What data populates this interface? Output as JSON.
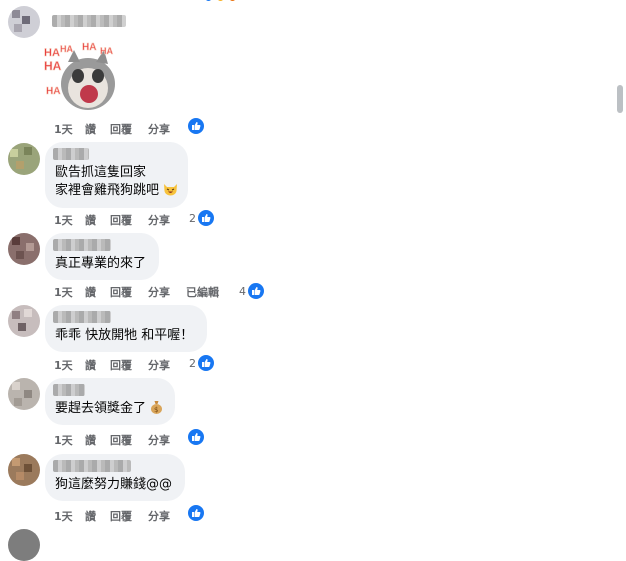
{
  "comments": [
    {
      "sticker": {
        "text": "HAHA",
        "colors": {
          "text": "#e8383a",
          "outline": "#f6c8b6"
        }
      },
      "actions": {
        "time": "1天",
        "like": "讚",
        "reply": "回覆",
        "share": "分享"
      },
      "reactions": null
    },
    {
      "lines": [
        "歐告抓這隻回家",
        "家裡會雞飛狗跳吧"
      ],
      "emoji": "laughing-cat-face",
      "actions": {
        "time": "1天",
        "like": "讚",
        "reply": "回覆",
        "share": "分享"
      },
      "reactions": "2"
    },
    {
      "lines": [
        "真正專業的來了"
      ],
      "actions": {
        "time": "1天",
        "like": "讚",
        "reply": "回覆",
        "share": "分享",
        "edited": "已編輯"
      },
      "reactions": "4"
    },
    {
      "lines": [
        "乖乖 快放開牠 和平喔！"
      ],
      "actions": {
        "time": "1天",
        "like": "讚",
        "reply": "回覆",
        "share": "分享"
      },
      "reactions": "2"
    },
    {
      "lines": [
        "要趕去領獎金了"
      ],
      "emoji": "money-bag",
      "actions": {
        "time": "1天",
        "like": "讚",
        "reply": "回覆",
        "share": "分享"
      },
      "reactions": null
    },
    {
      "lines": [
        "狗這麼努力賺錢@@"
      ],
      "actions": {
        "time": "1天",
        "like": "讚",
        "reply": "回覆",
        "share": "分享"
      },
      "reactions": null
    }
  ],
  "icons": {
    "like": "thumbs-up-icon"
  },
  "colors": {
    "accent": "#1877f2",
    "bubble": "#f0f2f5",
    "meta": "#65676b"
  }
}
